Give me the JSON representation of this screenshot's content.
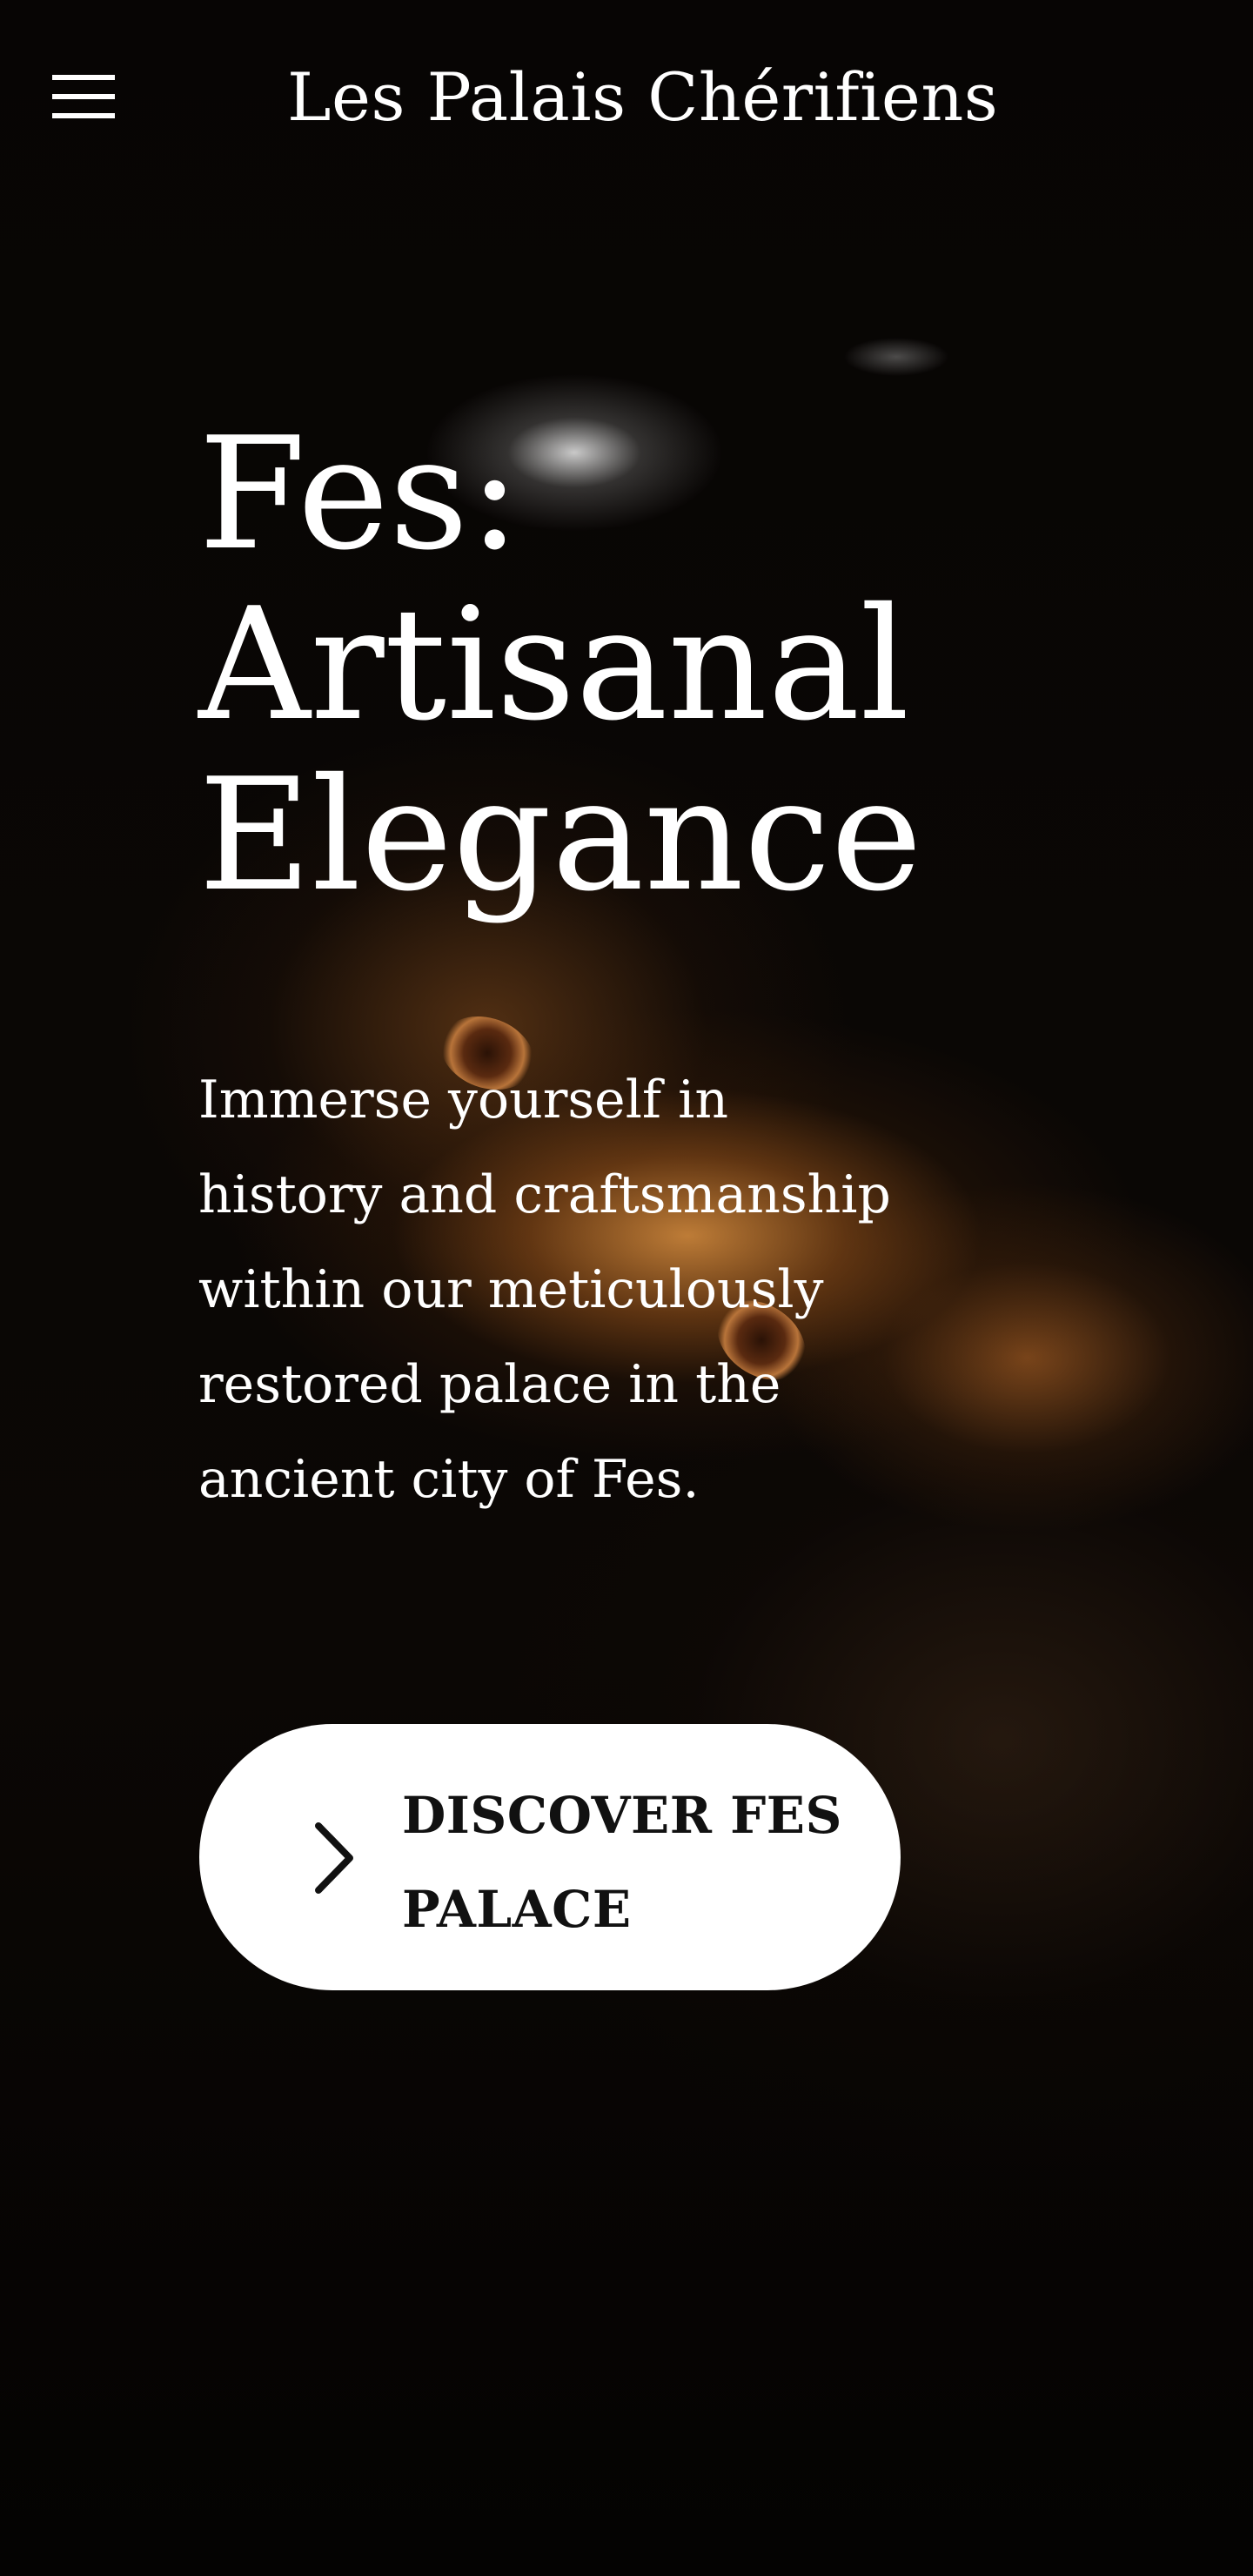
{
  "header": {
    "site_title": "Les Palais Chérifiens",
    "menu_icon": "hamburger-menu-icon"
  },
  "hero": {
    "headline_lines": [
      "Fes:",
      "Artisanal",
      "Elegance"
    ],
    "body_lines": [
      "Immerse yourself in",
      "history and craftsmanship",
      "within our meticulously",
      "restored palace in the",
      "ancient city of Fes."
    ],
    "cta": {
      "label_lines": [
        "DISCOVER FES",
        "PALACE"
      ],
      "icon": "chevron-right-icon"
    }
  },
  "colors": {
    "background": "#050302",
    "text": "#ffffff",
    "button_background": "#ffffff",
    "button_text": "#111111"
  }
}
